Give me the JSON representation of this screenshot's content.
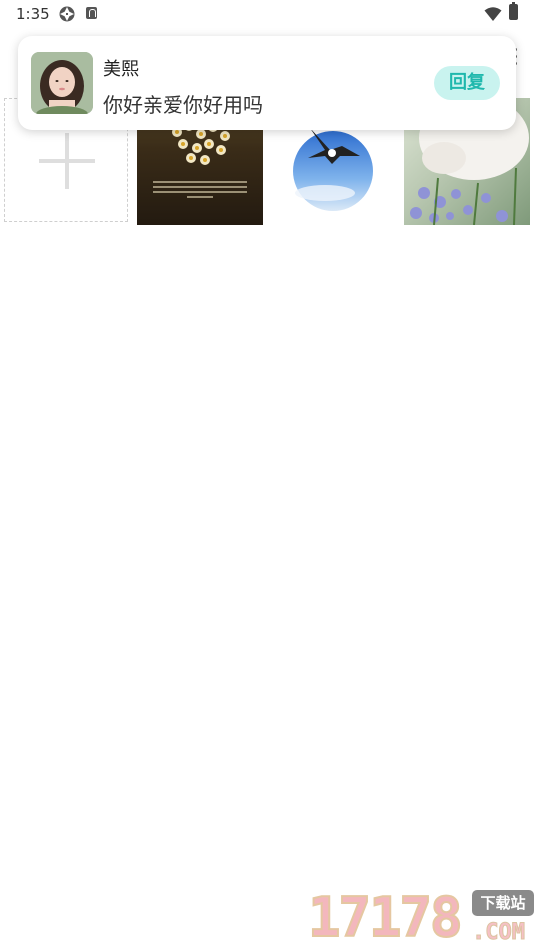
{
  "status_bar": {
    "time": "1:35"
  },
  "notification": {
    "sender_name": "美熙",
    "message": "你好亲爱你好用吗",
    "reply_label": "回复"
  },
  "gallery": {
    "add_icon": "plus-icon",
    "photos": [
      "daisy-poem-photo",
      "bird-sky-photo",
      "cat-flowers-photo"
    ]
  },
  "watermark": {
    "number": "17178",
    "badge": "下载站",
    "domain": ".COM"
  },
  "colors": {
    "reply_bg": "#c9f3ef",
    "reply_text": "#1fb8ad"
  }
}
